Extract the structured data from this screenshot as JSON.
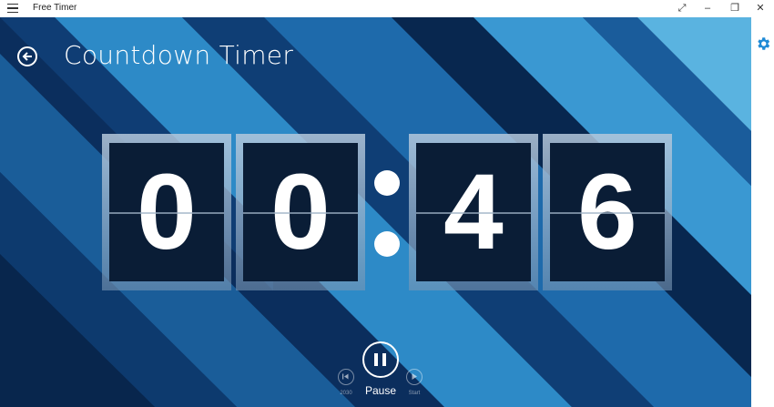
{
  "app": {
    "title": "Free Timer"
  },
  "window_controls": {
    "fullscreen_icon": "expand-icon",
    "minimize_icon": "minimize-icon",
    "restore_icon": "restore-icon",
    "close_icon": "close-icon"
  },
  "header": {
    "title": "Countdown Timer",
    "back_icon": "back-arrow-icon"
  },
  "settings": {
    "icon": "gear-icon",
    "color": "#1e8ad6"
  },
  "timer": {
    "digits": [
      "0",
      "0",
      "4",
      "6"
    ],
    "separator": ":"
  },
  "controls": {
    "pause_label": "Pause",
    "reset_label": "2030",
    "start_label": "Start"
  },
  "colors": {
    "background_dark": "#0b2e5d",
    "stripe_light": "#3d9dd3",
    "stripe_mid": "#1f6aa8",
    "digit_bg": "#0a1d36"
  }
}
